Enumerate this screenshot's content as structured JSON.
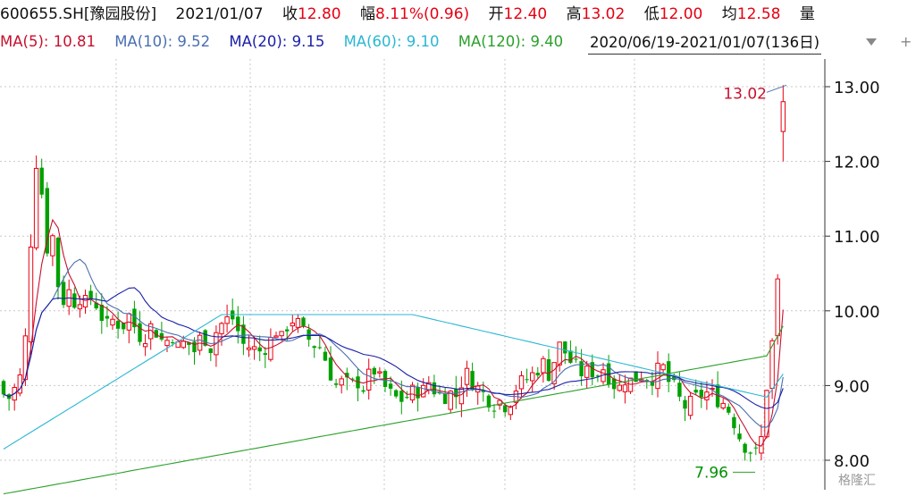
{
  "header": {
    "code": "600655.SH[豫园股份]",
    "date": "2021/01/07",
    "close_label": "收",
    "close": "12.80",
    "change_label": "幅",
    "change": "8.11%(0.96)",
    "open_label": "开",
    "open": "12.40",
    "high_label": "高",
    "high": "13.02",
    "low_label": "低",
    "low": "12.00",
    "avg_label": "均",
    "avg": "12.58",
    "volume_label": "量"
  },
  "ma_bar": {
    "ma5": "MA(5): 10.81",
    "ma10": "MA(10): 9.52",
    "ma20": "MA(20): 9.15",
    "ma60": "MA(60): 9.10",
    "ma120": "MA(120): 9.40",
    "range": "2020/06/19-2021/01/07(136日)",
    "colors": {
      "ma5": "#c8102e",
      "ma10": "#4a6fb0",
      "ma20": "#1a1fa8",
      "ma60": "#2bb7d4",
      "ma120": "#2ca02c"
    }
  },
  "watermark": "格隆汇",
  "chart_data": {
    "type": "candlestick",
    "y_ticks": [
      "13.00",
      "12.00",
      "11.00",
      "10.00",
      "9.00",
      "8.00"
    ],
    "ylim": [
      7.72,
      13.2
    ],
    "grid": "dashed",
    "up_color": "#e60012",
    "down_color": "#00a000",
    "annotations": [
      {
        "text": "13.02",
        "value": 13.02,
        "color": "#c8102e"
      },
      {
        "text": "7.96",
        "value": 7.96,
        "color": "#009000"
      }
    ],
    "ma_lines": [
      {
        "name": "MA5",
        "color": "#c8102e"
      },
      {
        "name": "MA10",
        "color": "#4a6fb0"
      },
      {
        "name": "MA20",
        "color": "#1a1fa8"
      },
      {
        "name": "MA60",
        "color": "#2bb7d4"
      },
      {
        "name": "MA120",
        "color": "#2ca02c"
      }
    ]
  }
}
